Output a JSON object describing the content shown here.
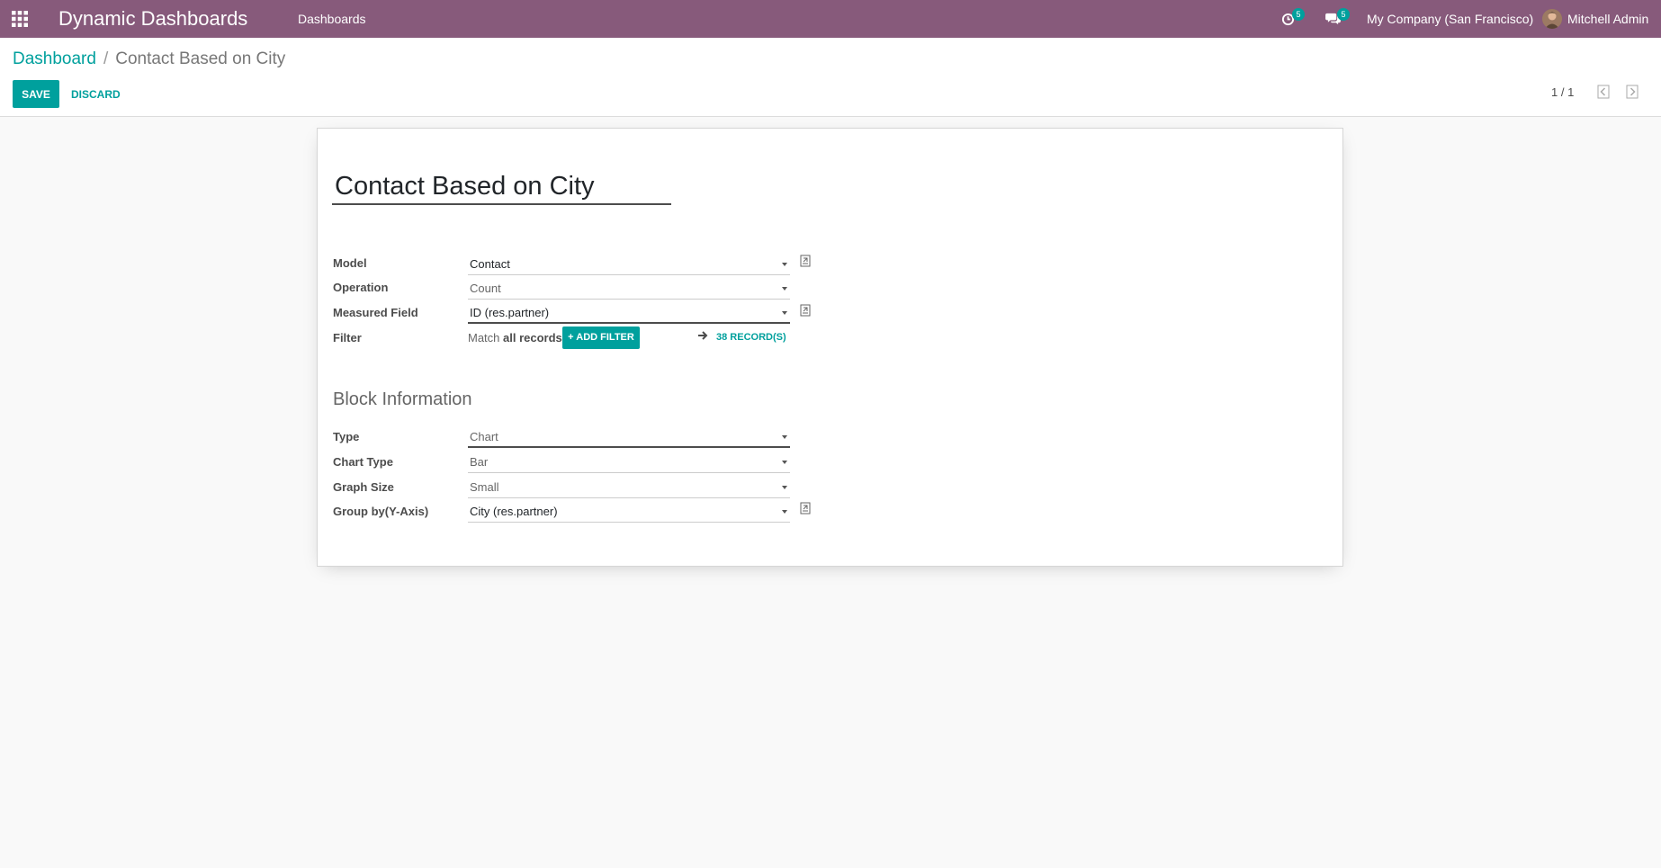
{
  "navbar": {
    "app_title": "Dynamic Dashboards",
    "menu": "Dashboards",
    "activity_count": "5",
    "message_count": "5",
    "company": "My Company (San Francisco)",
    "user": "Mitchell Admin"
  },
  "control_panel": {
    "breadcrumb_root": "Dashboard",
    "breadcrumb_current": "Contact Based on City",
    "save_label": "SAVE",
    "discard_label": "DISCARD",
    "pager": "1 / 1"
  },
  "form": {
    "name": "Contact Based on City",
    "fields": {
      "model": {
        "label": "Model",
        "value": "Contact"
      },
      "operation": {
        "label": "Operation",
        "value": "Count"
      },
      "measured_field": {
        "label": "Measured Field",
        "value": "ID (res.partner)"
      },
      "filter": {
        "label": "Filter",
        "match_prefix": "Match",
        "match_value": "all records",
        "add_filter": "ADD FILTER",
        "records": "38 RECORD(S)"
      }
    },
    "block_section": "Block Information",
    "block_fields": {
      "type": {
        "label": "Type",
        "value": "Chart"
      },
      "chart_type": {
        "label": "Chart Type",
        "value": "Bar"
      },
      "graph_size": {
        "label": "Graph Size",
        "value": "Small"
      },
      "group_by": {
        "label": "Group by(Y-Axis)",
        "value": "City (res.partner)"
      }
    }
  },
  "colors": {
    "navbar": "#875a7b",
    "accent": "#00a09d"
  },
  "icons": {
    "apps": "apps-grid-icon",
    "activity": "clock-icon",
    "messages": "chat-icon",
    "pager_prev": "pager-prev-icon",
    "pager_next": "pager-next-icon",
    "external": "external-link-icon",
    "arrow": "arrow-right-icon"
  }
}
